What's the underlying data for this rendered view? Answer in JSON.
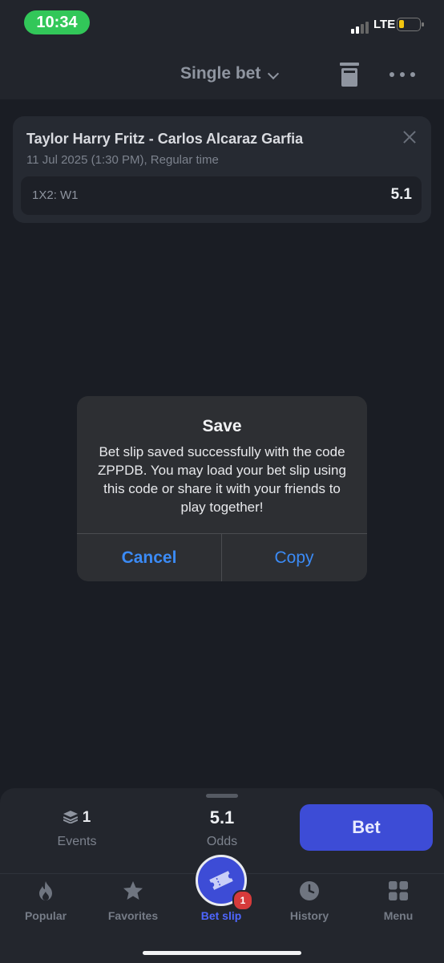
{
  "status": {
    "time": "10:34",
    "network": "LTE"
  },
  "header": {
    "title": "Single bet"
  },
  "bet": {
    "match": "Taylor Harry Fritz - Carlos Alcaraz Garfia",
    "datetime": "11 Jul 2025 (1:30 PM), Regular time",
    "market": "1X2: W1",
    "odds": "5.1"
  },
  "dialog": {
    "title": "Save",
    "message": "Bet slip saved successfully with the code ZPPDB. You may load your bet slip using this code or share it with your friends to play together!",
    "cancel_label": "Cancel",
    "copy_label": "Copy"
  },
  "summary": {
    "events_count": "1",
    "events_label": "Events",
    "odds_value": "5.1",
    "odds_label": "Odds",
    "bet_label": "Bet"
  },
  "tabs": [
    {
      "label": "Popular",
      "icon": "flame-icon"
    },
    {
      "label": "Favorites",
      "icon": "star-icon"
    },
    {
      "label": "Bet slip",
      "icon": "ticket-icon",
      "badge": "1",
      "active": true
    },
    {
      "label": "History",
      "icon": "clock-icon"
    },
    {
      "label": "Menu",
      "icon": "grid-icon"
    }
  ],
  "colors": {
    "accent": "#3d4cd6",
    "link": "#3b8bf6",
    "status_green": "#32c759",
    "badge_red": "#d63b3b"
  }
}
